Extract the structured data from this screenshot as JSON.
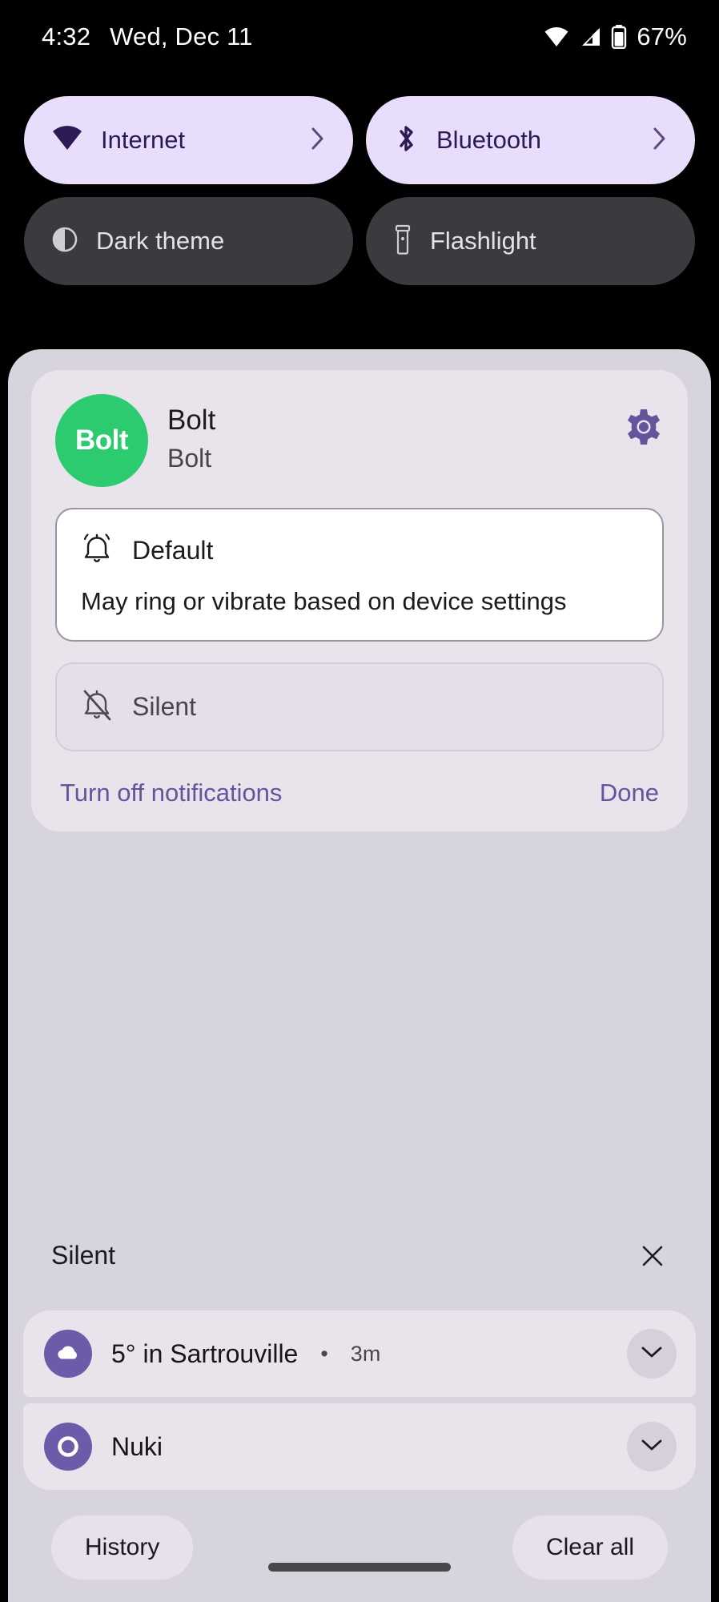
{
  "status_bar": {
    "time": "4:32",
    "date": "Wed, Dec 11",
    "battery_percent": "67%",
    "icons": [
      "wifi-icon",
      "cellular-signal-icon",
      "battery-icon"
    ]
  },
  "quick_settings": {
    "tiles": [
      {
        "label": "Internet",
        "icon": "wifi-icon",
        "state": "active",
        "has_chevron": true
      },
      {
        "label": "Bluetooth",
        "icon": "bluetooth-icon",
        "state": "active",
        "has_chevron": true
      },
      {
        "label": "Dark theme",
        "icon": "dark-theme-icon",
        "state": "inactive",
        "has_chevron": false
      },
      {
        "label": "Flashlight",
        "icon": "flashlight-icon",
        "state": "inactive",
        "has_chevron": false
      }
    ]
  },
  "notification_controls": {
    "app_name": "Bolt",
    "channel_name": "Bolt",
    "logo_text": "Bolt",
    "logo_color": "#2DCB70",
    "settings_icon": "gear-icon",
    "options": [
      {
        "label": "Default",
        "description": "May ring or vibrate based on device settings",
        "icon": "bell-ring-icon",
        "selected": true
      },
      {
        "label": "Silent",
        "description": "",
        "icon": "bell-off-icon",
        "selected": false
      }
    ],
    "turn_off_label": "Turn off notifications",
    "done_label": "Done",
    "accent_color": "#65539C"
  },
  "silent_section": {
    "title": "Silent",
    "close_icon": "close-icon",
    "notifications": [
      {
        "title": "5° in Sartrouville",
        "separator": "•",
        "time": "3m",
        "icon": "weather-cloud-icon",
        "icon_color": "#6B5BA8",
        "expand_icon": "chevron-down-icon"
      },
      {
        "title": "Nuki",
        "separator": "",
        "time": "",
        "icon": "nuki-ring-icon",
        "icon_color": "#6B5BA8",
        "expand_icon": "chevron-down-icon"
      }
    ]
  },
  "footer": {
    "history_label": "History",
    "clear_all_label": "Clear all"
  }
}
